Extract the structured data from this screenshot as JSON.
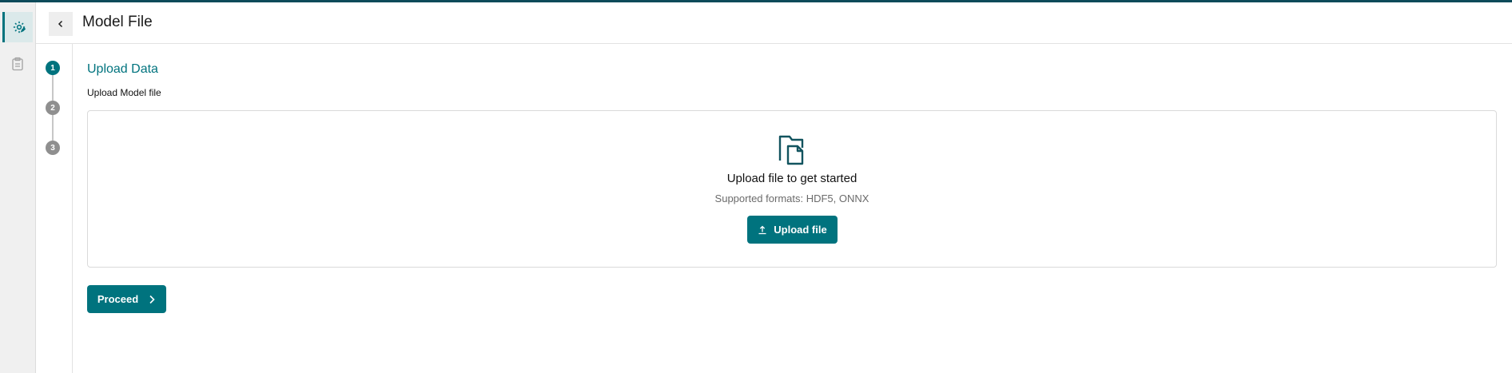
{
  "header": {
    "title": "Model File",
    "back_icon": "chevron-left-icon"
  },
  "sidebar": {
    "items": [
      {
        "icon": "model-gear-icon",
        "active": true
      },
      {
        "icon": "clipboard-icon",
        "active": false
      }
    ]
  },
  "stepper": {
    "steps": [
      "1",
      "2",
      "3"
    ],
    "active_step": 1
  },
  "section": {
    "title": "Upload Data",
    "field_label": "Upload Model file"
  },
  "dropzone": {
    "icon": "file-folder-icon",
    "title": "Upload file to get started",
    "subtitle": "Supported formats: HDF5, ONNX",
    "upload_label": "Upload file",
    "upload_icon": "upload-icon"
  },
  "actions": {
    "proceed_label": "Proceed",
    "proceed_icon": "chevron-right-icon"
  },
  "colors": {
    "accent": "#00737e",
    "topbar": "#0d4a5a",
    "step_inactive": "#8f8f8f"
  }
}
